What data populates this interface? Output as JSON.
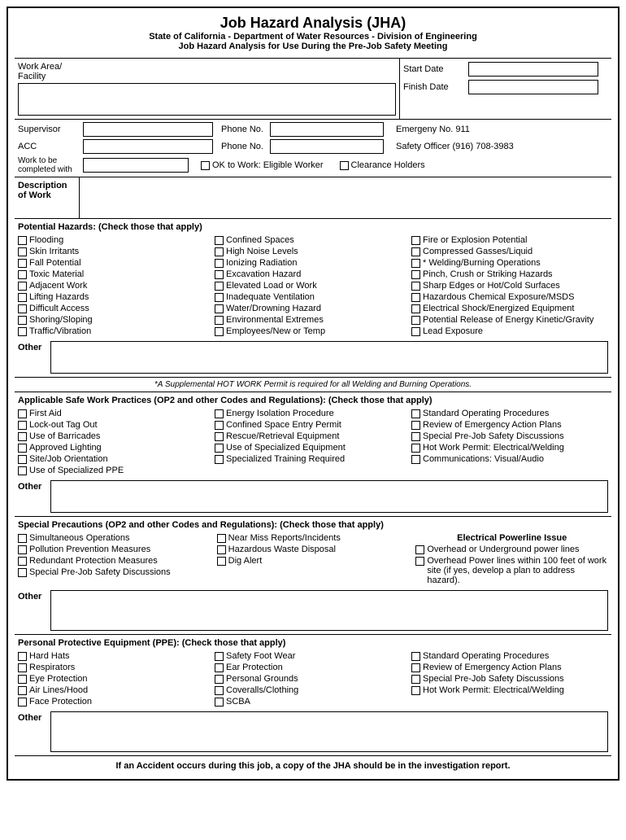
{
  "header": {
    "title": "Job Hazard Analysis (JHA)",
    "subtitle": "State of California - Department of Water Resources - Division of Engineering",
    "subtitle2": "Job Hazard Analysis for Use During the Pre-Job Safety Meeting"
  },
  "top_fields": {
    "work_area_label": "Work Area/\nFacility",
    "start_date_label": "Start Date",
    "finish_date_label": "Finish Date"
  },
  "middle_fields": {
    "supervisor_label": "Supervisor",
    "phone_label": "Phone No.",
    "emergency_label": "Emergeny No. 911",
    "acc_label": "ACC",
    "safety_officer_label": "Safety Officer (916) 708-3983",
    "work_completed_label": "Work to be\ncompleted with",
    "ok_to_work_label": "OK to Work: Eligible Worker",
    "clearance_holders_label": "Clearance Holders"
  },
  "description": {
    "label": "Description\nof Work"
  },
  "potential_hazards": {
    "title": "Potential Hazards: (Check those that apply)",
    "col1": [
      "Flooding",
      "Skin Irritants",
      "Fall Potential",
      "Toxic Material",
      "Adjacent Work",
      "Lifting Hazards",
      "Difficult Access",
      "Shoring/Sloping",
      "Traffic/Vibration"
    ],
    "col2": [
      "Confined Spaces",
      "High Noise Levels",
      "Ionizing Radiation",
      "Excavation Hazard",
      "Elevated Load or Work",
      "Inadequate Ventilation",
      "Water/Drowning Hazard",
      "Environmental Extremes",
      "Employees/New or Temp"
    ],
    "col3": [
      "Fire or Explosion Potential",
      "Compressed Gasses/Liquid",
      "* Welding/Burning Operations",
      "Pinch, Crush or Striking Hazards",
      "Sharp Edges or Hot/Cold Surfaces",
      "Hazardous Chemical Exposure/MSDS",
      "Electrical Shock/Energized Equipment",
      "Potential Release of Energy Kinetic/Gravity",
      "Lead Exposure"
    ],
    "other_label": "Other"
  },
  "hot_work_note": "*A Supplemental HOT WORK Permit is required for all Welding and Burning Operations.",
  "safe_practices": {
    "title": "Applicable Safe Work Practices (OP2 and other Codes and Regulations): (Check those that apply)",
    "col1": [
      "First Aid",
      "Lock-out Tag Out",
      "Use of Barricades",
      "Approved Lighting",
      "Site/Job Orientation",
      "Use of Specialized PPE"
    ],
    "col2": [
      "Energy Isolation Procedure",
      "Confined Space Entry Permit",
      "Rescue/Retrieval Equipment",
      "Use of Specialized Equipment",
      "Specialized Training Required"
    ],
    "col3": [
      "Standard Operating Procedures",
      "Review of Emergency Action Plans",
      "Special Pre-Job Safety Discussions",
      "Hot Work Permit: Electrical/Welding",
      "Communications: Visual/Audio"
    ],
    "other_label": "Other"
  },
  "special_precautions": {
    "title": "Special Precautions (OP2 and other Codes and Regulations): (Check those that apply)",
    "col1": [
      "Simultaneous Operations",
      "Pollution Prevention Measures",
      "Redundant Protection Measures",
      "Special Pre-Job Safety Discussions"
    ],
    "col2": [
      "Near Miss Reports/Incidents",
      "Hazardous Waste Disposal",
      "Dig Alert"
    ],
    "electrical_title": "Electrical Powerline Issue",
    "col3": [
      "Overhead or Underground power lines",
      "Overhead Power lines within 100 feet of work site (if yes, develop a plan to address hazard)."
    ],
    "other_label": "Other"
  },
  "ppe": {
    "title": "Personal Protective Equipment (PPE): (Check those that apply)",
    "col1": [
      "Hard Hats",
      "Respirators",
      "Eye Protection",
      "Air Lines/Hood",
      "Face Protection"
    ],
    "col2": [
      "Safety Foot Wear",
      "Ear Protection",
      "Personal Grounds",
      "Coveralls/Clothing",
      "SCBA"
    ],
    "col3": [
      "Standard Operating Procedures",
      "Review of Emergency Action Plans",
      "Special Pre-Job Safety Discussions",
      "Hot Work Permit: Electrical/Welding"
    ],
    "other_label": "Other"
  },
  "footer": {
    "text": "If an Accident occurs during this job, a copy of the JHA should be in the investigation report."
  }
}
